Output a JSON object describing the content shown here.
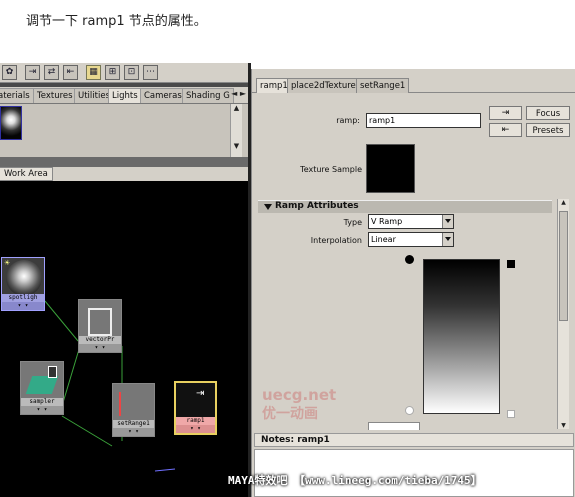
{
  "caption": "调节一下 ramp1 节点的属性。",
  "left_panel": {
    "toolbar_icons": [
      "hypergraph-icon",
      "input-output-icon",
      "input-icon",
      "output-icon",
      "graph-layout-icon",
      "grid-icon",
      "snap-icon",
      "clear-icon"
    ],
    "tabs": [
      "aterials",
      "Textures",
      "Utilities",
      "Lights",
      "Cameras",
      "Shading G"
    ],
    "active_tab": "Lights",
    "scroll_left": "◄",
    "scroll_right": "►",
    "work_tab": "Work Area",
    "nodes": [
      {
        "label": "spotligh",
        "type": "spotlight"
      },
      {
        "label": "vectorPr",
        "type": "vectorProduct"
      },
      {
        "label": "sampler",
        "type": "samplerInfo"
      },
      {
        "label": "setRange1",
        "type": "setRange"
      },
      {
        "label": "ramp1",
        "type": "ramp"
      }
    ]
  },
  "right_panel": {
    "tabs": [
      "ramp1",
      "place2dTexture1",
      "setRange1"
    ],
    "active_tab": "ramp1",
    "ramp_label": "ramp:",
    "ramp_value": "ramp1",
    "focus_button": "Focus",
    "presets_button": "Presets",
    "texture_sample_label": "Texture Sample",
    "section_title": "Ramp Attributes",
    "type_label": "Type",
    "type_value": "V Ramp",
    "interpolation_label": "Interpolation",
    "interpolation_value": "Linear",
    "notes_label": "Notes:  ramp1"
  },
  "watermark": {
    "logo_text": "uecg.net",
    "sub_text": "优一动画",
    "footer": "MAYA特效吧 【www.lineeg.com/tieba/1745】"
  },
  "colors": {
    "maya_panel": "#d4d0c8",
    "work_area": "#000000",
    "ramp_node_border": "#e8d060",
    "node_link": "#3aa03a"
  }
}
